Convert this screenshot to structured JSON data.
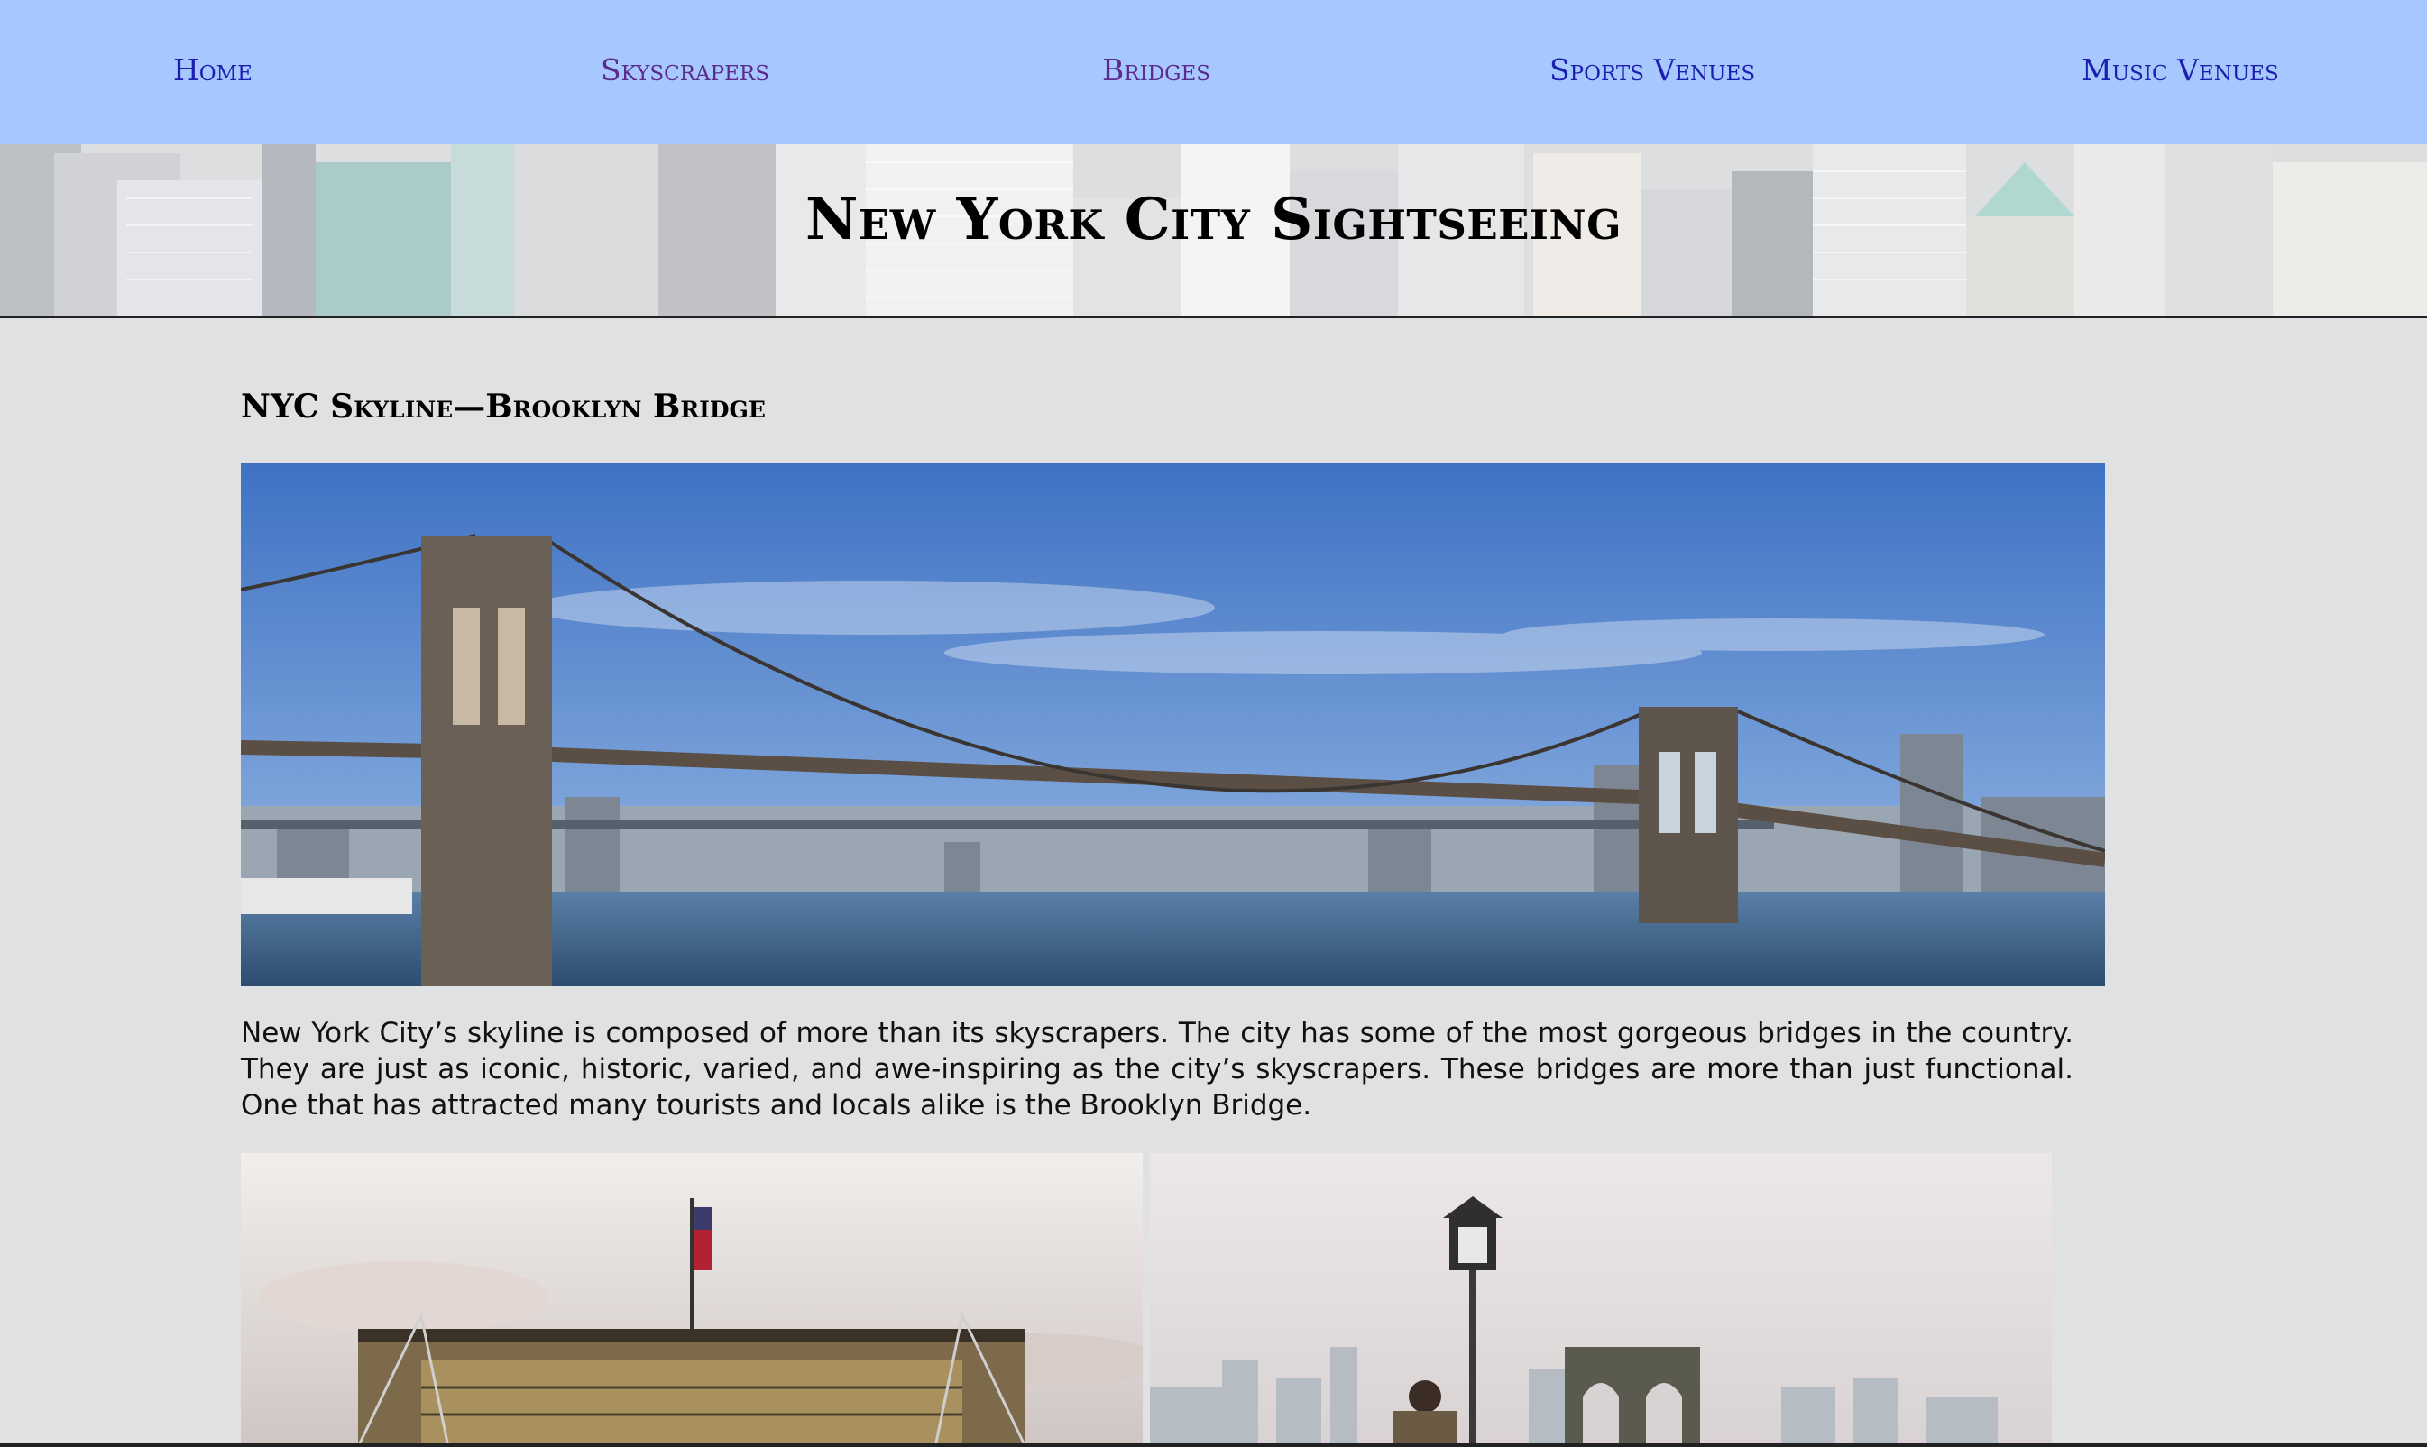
{
  "nav": {
    "items": [
      {
        "label": "Home"
      },
      {
        "label": "Skyscrapers"
      },
      {
        "label": "Bridges"
      },
      {
        "label": "Sports Venues"
      },
      {
        "label": "Music Venues"
      }
    ]
  },
  "banner": {
    "title": "New York City Sightseeing"
  },
  "main": {
    "section_title": "NYC Skyline—Brooklyn Bridge",
    "intro": "New York City’s skyline is composed of more than its skyscrapers. The city has some of the most gorgeous bridges in the country. They are just as iconic, historic, varied, and awe-inspiring as the city’s skyscrapers. These bridges are more than just functional. One that has attracted many tourists and locals alike is the Brooklyn Bridge."
  },
  "colors": {
    "nav_background": "#a6c8ff",
    "link": "#1c1eb0",
    "visited_link": "#5a2a8c",
    "page_background": "#dfe1e3"
  }
}
